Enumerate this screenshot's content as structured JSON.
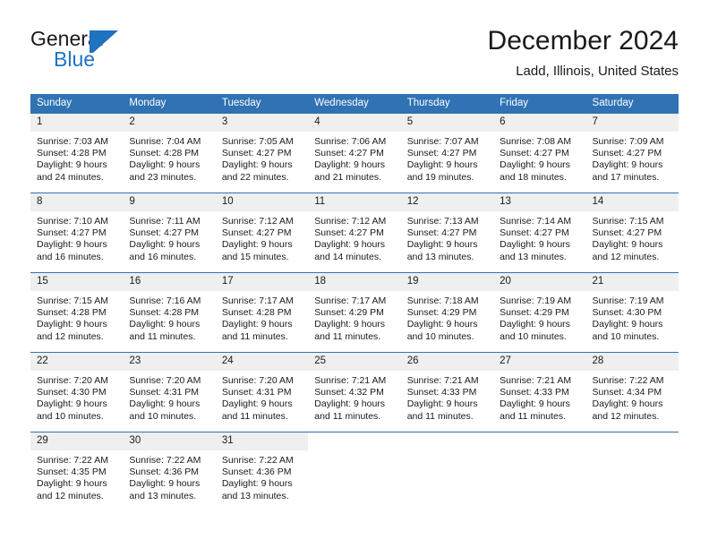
{
  "brand": {
    "name_part1": "General",
    "name_part2": "Blue"
  },
  "header": {
    "title": "December 2024",
    "location": "Ladd, Illinois, United States"
  },
  "colors": {
    "header_blue": "#3072b3",
    "logo_blue": "#1f72c0",
    "daynum_band": "#efefef",
    "text": "#1a1a1a"
  },
  "weekdays": [
    "Sunday",
    "Monday",
    "Tuesday",
    "Wednesday",
    "Thursday",
    "Friday",
    "Saturday"
  ],
  "weeks": [
    [
      {
        "day": "1",
        "sunrise": "Sunrise: 7:03 AM",
        "sunset": "Sunset: 4:28 PM",
        "daylight_line1": "Daylight: 9 hours",
        "daylight_line2": "and 24 minutes."
      },
      {
        "day": "2",
        "sunrise": "Sunrise: 7:04 AM",
        "sunset": "Sunset: 4:28 PM",
        "daylight_line1": "Daylight: 9 hours",
        "daylight_line2": "and 23 minutes."
      },
      {
        "day": "3",
        "sunrise": "Sunrise: 7:05 AM",
        "sunset": "Sunset: 4:27 PM",
        "daylight_line1": "Daylight: 9 hours",
        "daylight_line2": "and 22 minutes."
      },
      {
        "day": "4",
        "sunrise": "Sunrise: 7:06 AM",
        "sunset": "Sunset: 4:27 PM",
        "daylight_line1": "Daylight: 9 hours",
        "daylight_line2": "and 21 minutes."
      },
      {
        "day": "5",
        "sunrise": "Sunrise: 7:07 AM",
        "sunset": "Sunset: 4:27 PM",
        "daylight_line1": "Daylight: 9 hours",
        "daylight_line2": "and 19 minutes."
      },
      {
        "day": "6",
        "sunrise": "Sunrise: 7:08 AM",
        "sunset": "Sunset: 4:27 PM",
        "daylight_line1": "Daylight: 9 hours",
        "daylight_line2": "and 18 minutes."
      },
      {
        "day": "7",
        "sunrise": "Sunrise: 7:09 AM",
        "sunset": "Sunset: 4:27 PM",
        "daylight_line1": "Daylight: 9 hours",
        "daylight_line2": "and 17 minutes."
      }
    ],
    [
      {
        "day": "8",
        "sunrise": "Sunrise: 7:10 AM",
        "sunset": "Sunset: 4:27 PM",
        "daylight_line1": "Daylight: 9 hours",
        "daylight_line2": "and 16 minutes."
      },
      {
        "day": "9",
        "sunrise": "Sunrise: 7:11 AM",
        "sunset": "Sunset: 4:27 PM",
        "daylight_line1": "Daylight: 9 hours",
        "daylight_line2": "and 16 minutes."
      },
      {
        "day": "10",
        "sunrise": "Sunrise: 7:12 AM",
        "sunset": "Sunset: 4:27 PM",
        "daylight_line1": "Daylight: 9 hours",
        "daylight_line2": "and 15 minutes."
      },
      {
        "day": "11",
        "sunrise": "Sunrise: 7:12 AM",
        "sunset": "Sunset: 4:27 PM",
        "daylight_line1": "Daylight: 9 hours",
        "daylight_line2": "and 14 minutes."
      },
      {
        "day": "12",
        "sunrise": "Sunrise: 7:13 AM",
        "sunset": "Sunset: 4:27 PM",
        "daylight_line1": "Daylight: 9 hours",
        "daylight_line2": "and 13 minutes."
      },
      {
        "day": "13",
        "sunrise": "Sunrise: 7:14 AM",
        "sunset": "Sunset: 4:27 PM",
        "daylight_line1": "Daylight: 9 hours",
        "daylight_line2": "and 13 minutes."
      },
      {
        "day": "14",
        "sunrise": "Sunrise: 7:15 AM",
        "sunset": "Sunset: 4:27 PM",
        "daylight_line1": "Daylight: 9 hours",
        "daylight_line2": "and 12 minutes."
      }
    ],
    [
      {
        "day": "15",
        "sunrise": "Sunrise: 7:15 AM",
        "sunset": "Sunset: 4:28 PM",
        "daylight_line1": "Daylight: 9 hours",
        "daylight_line2": "and 12 minutes."
      },
      {
        "day": "16",
        "sunrise": "Sunrise: 7:16 AM",
        "sunset": "Sunset: 4:28 PM",
        "daylight_line1": "Daylight: 9 hours",
        "daylight_line2": "and 11 minutes."
      },
      {
        "day": "17",
        "sunrise": "Sunrise: 7:17 AM",
        "sunset": "Sunset: 4:28 PM",
        "daylight_line1": "Daylight: 9 hours",
        "daylight_line2": "and 11 minutes."
      },
      {
        "day": "18",
        "sunrise": "Sunrise: 7:17 AM",
        "sunset": "Sunset: 4:29 PM",
        "daylight_line1": "Daylight: 9 hours",
        "daylight_line2": "and 11 minutes."
      },
      {
        "day": "19",
        "sunrise": "Sunrise: 7:18 AM",
        "sunset": "Sunset: 4:29 PM",
        "daylight_line1": "Daylight: 9 hours",
        "daylight_line2": "and 10 minutes."
      },
      {
        "day": "20",
        "sunrise": "Sunrise: 7:19 AM",
        "sunset": "Sunset: 4:29 PM",
        "daylight_line1": "Daylight: 9 hours",
        "daylight_line2": "and 10 minutes."
      },
      {
        "day": "21",
        "sunrise": "Sunrise: 7:19 AM",
        "sunset": "Sunset: 4:30 PM",
        "daylight_line1": "Daylight: 9 hours",
        "daylight_line2": "and 10 minutes."
      }
    ],
    [
      {
        "day": "22",
        "sunrise": "Sunrise: 7:20 AM",
        "sunset": "Sunset: 4:30 PM",
        "daylight_line1": "Daylight: 9 hours",
        "daylight_line2": "and 10 minutes."
      },
      {
        "day": "23",
        "sunrise": "Sunrise: 7:20 AM",
        "sunset": "Sunset: 4:31 PM",
        "daylight_line1": "Daylight: 9 hours",
        "daylight_line2": "and 10 minutes."
      },
      {
        "day": "24",
        "sunrise": "Sunrise: 7:20 AM",
        "sunset": "Sunset: 4:31 PM",
        "daylight_line1": "Daylight: 9 hours",
        "daylight_line2": "and 11 minutes."
      },
      {
        "day": "25",
        "sunrise": "Sunrise: 7:21 AM",
        "sunset": "Sunset: 4:32 PM",
        "daylight_line1": "Daylight: 9 hours",
        "daylight_line2": "and 11 minutes."
      },
      {
        "day": "26",
        "sunrise": "Sunrise: 7:21 AM",
        "sunset": "Sunset: 4:33 PM",
        "daylight_line1": "Daylight: 9 hours",
        "daylight_line2": "and 11 minutes."
      },
      {
        "day": "27",
        "sunrise": "Sunrise: 7:21 AM",
        "sunset": "Sunset: 4:33 PM",
        "daylight_line1": "Daylight: 9 hours",
        "daylight_line2": "and 11 minutes."
      },
      {
        "day": "28",
        "sunrise": "Sunrise: 7:22 AM",
        "sunset": "Sunset: 4:34 PM",
        "daylight_line1": "Daylight: 9 hours",
        "daylight_line2": "and 12 minutes."
      }
    ],
    [
      {
        "day": "29",
        "sunrise": "Sunrise: 7:22 AM",
        "sunset": "Sunset: 4:35 PM",
        "daylight_line1": "Daylight: 9 hours",
        "daylight_line2": "and 12 minutes."
      },
      {
        "day": "30",
        "sunrise": "Sunrise: 7:22 AM",
        "sunset": "Sunset: 4:36 PM",
        "daylight_line1": "Daylight: 9 hours",
        "daylight_line2": "and 13 minutes."
      },
      {
        "day": "31",
        "sunrise": "Sunrise: 7:22 AM",
        "sunset": "Sunset: 4:36 PM",
        "daylight_line1": "Daylight: 9 hours",
        "daylight_line2": "and 13 minutes."
      },
      {
        "day": "",
        "sunrise": "",
        "sunset": "",
        "daylight_line1": "",
        "daylight_line2": ""
      },
      {
        "day": "",
        "sunrise": "",
        "sunset": "",
        "daylight_line1": "",
        "daylight_line2": ""
      },
      {
        "day": "",
        "sunrise": "",
        "sunset": "",
        "daylight_line1": "",
        "daylight_line2": ""
      },
      {
        "day": "",
        "sunrise": "",
        "sunset": "",
        "daylight_line1": "",
        "daylight_line2": ""
      }
    ]
  ]
}
